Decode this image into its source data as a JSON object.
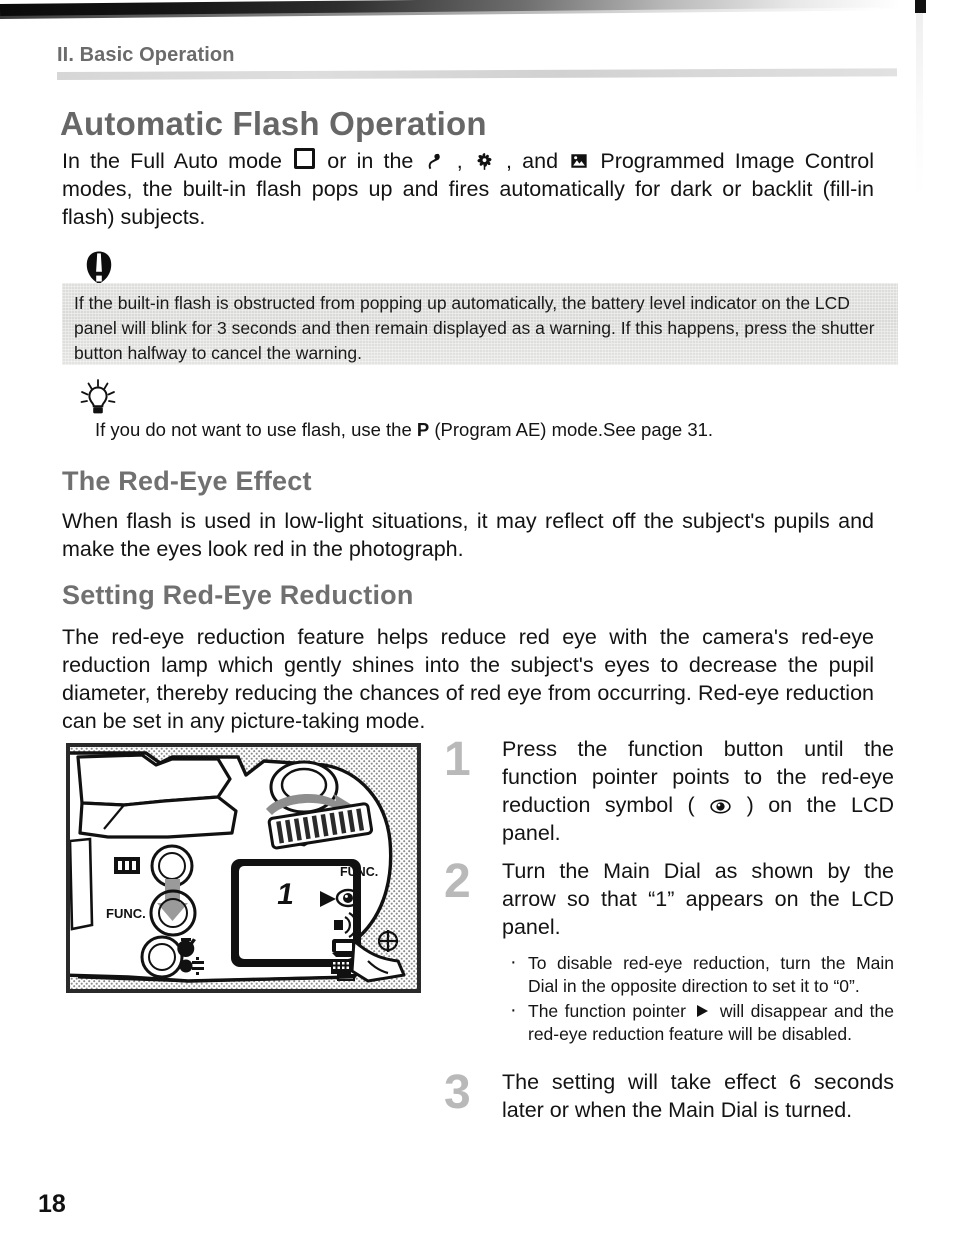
{
  "page": {
    "chapter": "II. Basic Operation",
    "folio": "18"
  },
  "title": "Automatic Flash Operation",
  "intro": {
    "part1": "In the Full Auto mode ",
    "part2": " or in the ",
    "part3": " , ",
    "part4": " , and ",
    "part5": " Programmed Image Control modes, the built-in flash pops up and fires automatically for dark or backlit (fill-in flash) subjects."
  },
  "caution": {
    "icon": "caution-icon",
    "text": "If the built-in flash is obstructed from popping up automatically, the battery level indicator on the LCD panel will blink for 3 seconds and then remain displayed as a warning. If this happens, press the shutter button halfway to cancel the warning."
  },
  "tip": {
    "icon": "lightbulb-icon",
    "before": "If you do not want to use flash, use the ",
    "bold": "P",
    "after": " (Program AE) mode.See page 31."
  },
  "sections": [
    {
      "heading": "The Red-Eye Effect",
      "body": "When flash is used in low-light situations, it may reflect off the subject's pupils and make the eyes look red in the photograph."
    },
    {
      "heading": "Setting Red-Eye Reduction",
      "body": "The red-eye reduction feature helps reduce red eye with the camera's red-eye reduction lamp which gently shines into the subject's eyes to decrease the pupil diameter, thereby reducing the chances of red eye from occurring. Red-eye reduction can be set in any picture-taking mode."
    }
  ],
  "figure": {
    "caption_labels": {
      "func_button": "FUNC",
      "lcd_func_header": "FUNC.",
      "lcd_value": "1"
    }
  },
  "steps": [
    {
      "number": "1",
      "text_before": "Press the function button until the function pointer points to the red-eye reduction symbol ( ",
      "text_after": " ) on the LCD panel."
    },
    {
      "number": "2",
      "text": "Turn the Main Dial as shown by the arrow so that “1” appears on the LCD panel.",
      "bullets": [
        {
          "text": "To disable red-eye reduction, turn the Main Dial in the opposite direction to set it to “0”."
        },
        {
          "text_before": "The function pointer ",
          "text_after": " will disappear and the red-eye reduction feature will be disabled."
        }
      ]
    },
    {
      "number": "3",
      "text": "The setting will take effect 6 seconds later or when the Main Dial is turned."
    }
  ]
}
